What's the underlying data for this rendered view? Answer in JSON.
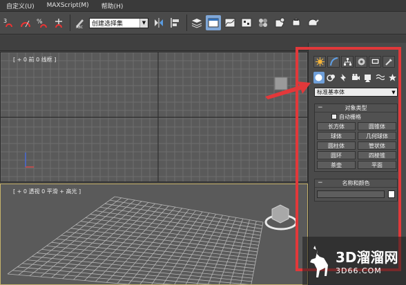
{
  "menu": {
    "items": [
      "自定义(U)",
      "MAXScript(M)",
      "帮助(H)"
    ]
  },
  "toolbar": {
    "selection_set_placeholder": "创建选择集",
    "icons": [
      "snap-3d-icon",
      "angle-snap-icon",
      "percent-snap-icon",
      "spinner-snap-icon",
      "edit-named-selection-icon",
      "mirror-icon",
      "align-icon",
      "layer-manager-icon",
      "scene-explorer-icon",
      "curve-editor-icon",
      "schematic-view-icon",
      "material-editor-icon",
      "render-setup-icon",
      "rendered-frame-icon",
      "render-production-icon"
    ]
  },
  "viewports": {
    "top_label": "[ + 0 前 0 线框 ]",
    "persp_label": "[ + 0 透视 0 平滑 + 高光 ]"
  },
  "command_panel": {
    "tabs": [
      "create-tab-icon",
      "modify-tab-icon",
      "hierarchy-tab-icon",
      "motion-tab-icon",
      "display-tab-icon",
      "utilities-tab-icon"
    ],
    "categories": [
      "geometry-icon",
      "shapes-icon",
      "lights-icon",
      "cameras-icon",
      "helpers-icon",
      "space-warps-icon",
      "systems-icon"
    ],
    "dropdown_value": "标准基本体",
    "object_type": {
      "title": "对象类型",
      "auto_grid": "自动栅格",
      "buttons": [
        "长方体",
        "圆锥体",
        "球体",
        "几何球体",
        "圆柱体",
        "管状体",
        "圆环",
        "四棱锥",
        "茶壶",
        "平面"
      ]
    },
    "name_color": {
      "title": "名称和颜色",
      "swatch_color": "#ffffff"
    }
  },
  "watermark": {
    "title": "3D溜溜网",
    "subtitle": "3D66.COM"
  },
  "colors": {
    "highlight_frame": "#e2383a",
    "active_tab": "#6f9fd9"
  }
}
